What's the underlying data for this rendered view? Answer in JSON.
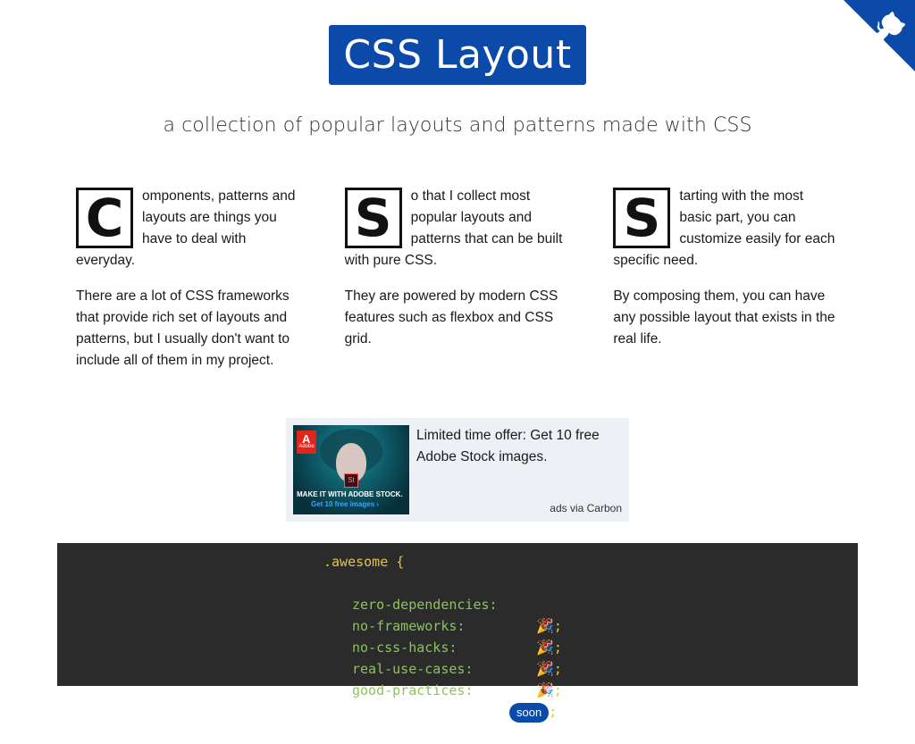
{
  "github_corner": {
    "icon": "github-octocat-icon",
    "color": "#0b4aa8"
  },
  "hero": {
    "logo_text": "CSS Layout",
    "tagline": "a collection of popular layouts and patterns made with CSS"
  },
  "columns": [
    {
      "dropcap": "C",
      "lead": "omponents, patterns and layouts are things you have to deal with everyday.",
      "body": "There are a lot of CSS frameworks that provide rich set of layouts and patterns, but I usually don't want to include all of them in my project."
    },
    {
      "dropcap": "S",
      "lead": "o that I collect most popular layouts and patterns that can be built with pure CSS.",
      "body": "They are powered by modern CSS features such as flexbox and CSS grid."
    },
    {
      "dropcap": "S",
      "lead": "tarting with the most basic part, you can customize easily for each specific need.",
      "body": "By composing them, you can have any possible layout that exists in the real life."
    }
  ],
  "ad": {
    "image_logo": "Adobe",
    "image_badge": "St",
    "image_slogan": "MAKE IT WITH ADOBE STOCK.",
    "image_cta": "Get 10 free images ›",
    "text": "Limited time offer: Get 10 free Adobe Stock images.",
    "via": "ads via Carbon"
  },
  "code": {
    "selector": ".awesome {",
    "rows": [
      {
        "prop": "zero-dependencies:",
        "value": "🎉",
        "semi": ";"
      },
      {
        "prop": "no-frameworks:",
        "value": "🎉",
        "semi": ";"
      },
      {
        "prop": "no-css-hacks:",
        "value": "🎉",
        "semi": ";"
      },
      {
        "prop": "real-use-cases:",
        "value": "🎉",
        "semi": ";"
      },
      {
        "prop": "good-practices:",
        "badge": "soon",
        "semi": ";"
      }
    ]
  }
}
